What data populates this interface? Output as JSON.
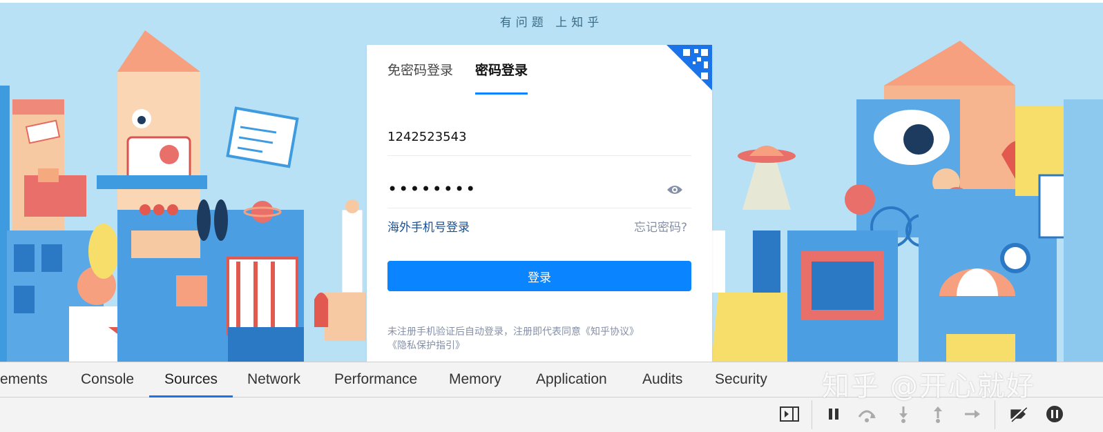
{
  "page": {
    "slogan": "有问题 上知乎"
  },
  "login": {
    "tabs": [
      {
        "label": "免密码登录",
        "active": false
      },
      {
        "label": "密码登录",
        "active": true
      }
    ],
    "username_value": "1242523543",
    "password_value": "••••••••",
    "overseas_link": "海外手机号登录",
    "forgot_link": "忘记密码?",
    "submit_label": "登录",
    "agreement_text": "未注册手机验证后自动登录，注册即代表同意",
    "agreement_link_1": "《知乎协议》",
    "agreement_link_2": "《隐私保护指引》",
    "accent_color": "#0a84ff"
  },
  "devtools": {
    "tabs": [
      {
        "label": "ements",
        "active": false
      },
      {
        "label": "Console",
        "active": false
      },
      {
        "label": "Sources",
        "active": true
      },
      {
        "label": "Network",
        "active": false
      },
      {
        "label": "Performance",
        "active": false
      },
      {
        "label": "Memory",
        "active": false
      },
      {
        "label": "Application",
        "active": false
      },
      {
        "label": "Audits",
        "active": false
      },
      {
        "label": "Security",
        "active": false
      }
    ],
    "toolbar_icons": [
      "toggle-navigator-icon",
      "pause-icon",
      "step-over-icon",
      "step-into-icon",
      "step-out-icon",
      "step-icon",
      "deactivate-breakpoints-icon",
      "pause-on-exceptions-icon"
    ]
  },
  "watermark": "知乎 @开心就好"
}
